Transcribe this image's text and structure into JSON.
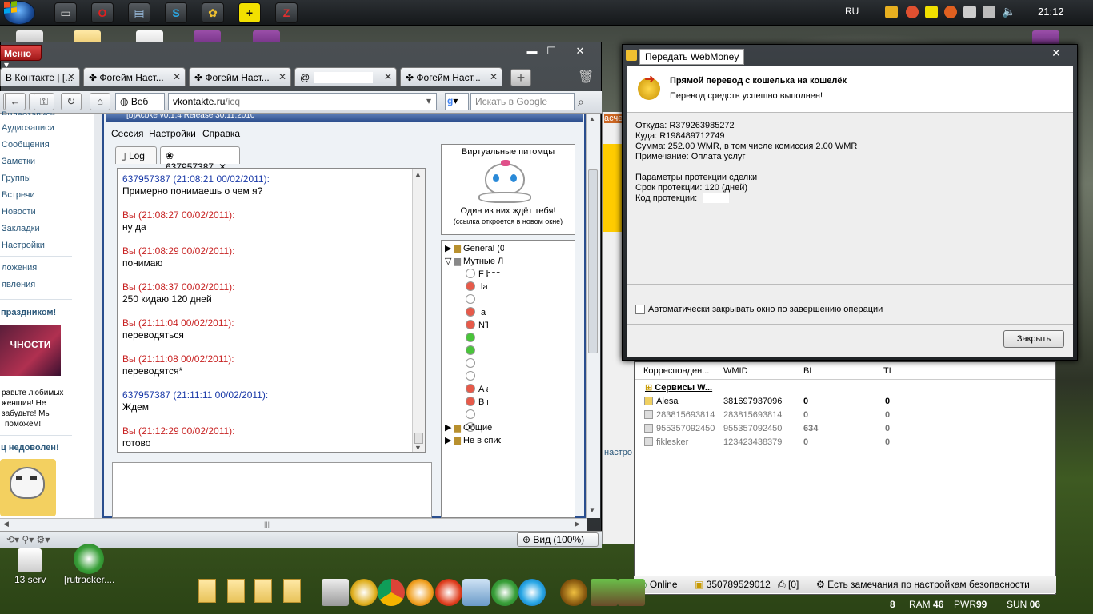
{
  "taskbar_top": {
    "language": "RU",
    "clock": "21:12"
  },
  "desktop": {
    "icons": [
      {
        "label": "13 serv"
      },
      {
        "label": "[rutracker...."
      }
    ]
  },
  "opera": {
    "menu_label": "Меню",
    "tabs": [
      {
        "label": "В Контакте | [..."
      },
      {
        "label": "Фогейм Наст..."
      },
      {
        "label": "Фогейм Наст..."
      },
      {
        "label": "@"
      },
      {
        "label": "Фогейм Наст..."
      }
    ],
    "search_engine_label": "Веб",
    "address_host": "vkontakte.ru",
    "address_path": "/icq",
    "search_placeholder": "Искать в Google",
    "zoom_label": "Вид (100%)"
  },
  "vk": {
    "top_cut": "Видеозаписи",
    "nav": [
      "Аудиозаписи",
      "Сообщения",
      "Заметки",
      "Группы",
      "Встречи",
      "Новости",
      "Закладки",
      "Настройки"
    ],
    "apps": [
      "ложения",
      "явления"
    ],
    "promo_title": "праздником!",
    "promo_text": [
      "равьте любимых",
      "женщин! Не",
      "забудьте! Мы",
      "поможем!"
    ],
    "promo_image_text": "ЧНОСТИ",
    "app2_title": "ц недоволен!"
  },
  "icq": {
    "title": "[b]Acbke v0.1.4 Release 30.11.2010",
    "menu": [
      "Сессия",
      "Настройки",
      "Справка"
    ],
    "tabs": [
      {
        "label": "Log"
      },
      {
        "label": "637957387"
      }
    ],
    "messages": [
      {
        "from": "them",
        "header": "637957387 (21:08:21 00/02/2011):",
        "text": "Примерно понимаешь о чем я?"
      },
      {
        "from": "me",
        "header": "Вы (21:08:27 00/02/2011):",
        "text": "ну да"
      },
      {
        "from": "me",
        "header": "Вы (21:08:29 00/02/2011):",
        "text": "понимаю"
      },
      {
        "from": "me",
        "header": "Вы (21:08:37 00/02/2011):",
        "text": "250 кидаю 120 дней"
      },
      {
        "from": "me",
        "header": "Вы (21:11:04 00/02/2011):",
        "text": "переводяться"
      },
      {
        "from": "me",
        "header": "Вы (21:11:08 00/02/2011):",
        "text": "переводятся*"
      },
      {
        "from": "them",
        "header": "637957387 (21:11:11 00/02/2011):",
        "text": "Ждем"
      },
      {
        "from": "me",
        "header": "Вы (21:12:29 00/02/2011):",
        "text": "готово"
      }
    ],
    "pets": {
      "title": "Виртуальные питомцы",
      "text": "Один из них ждёт тебя!",
      "note": "(ссылка откроется в новом окне)"
    },
    "groups": [
      {
        "label": "General (0"
      },
      {
        "label": "Мутные Люди"
      },
      {
        "label": "Общие"
      },
      {
        "label": "Не в списке"
      }
    ],
    "contacts": [
      {
        "label": "F  bos",
        "color": "#ffffff"
      },
      {
        "label": "   las",
        "color": "#e65a4a"
      },
      {
        "label": "",
        "color": "#ffffff"
      },
      {
        "label": "  a ",
        "color": "#e65a4a"
      },
      {
        "label": "NT  ",
        "color": "#e65a4a"
      },
      {
        "label": "",
        "color": "#49c43a"
      },
      {
        "label": "",
        "color": "#49c43a"
      },
      {
        "label": "",
        "color": "#ffffff"
      },
      {
        "label": "",
        "color": "#ffffff"
      },
      {
        "label": "A      a",
        "color": "#e65a4a"
      },
      {
        "label": "B    nnat",
        "color": "#e65a4a"
      },
      {
        "label": "",
        "color": "#ffffff"
      },
      {
        "label": "",
        "color": "#ffffff"
      }
    ]
  },
  "webmoney_dialog": {
    "title": "Передать WebMoney",
    "heading": "Прямой перевод с кошелька на кошелёк",
    "subheading": "Перевод средств успешно выполнен!",
    "from": "Откуда: R379263985272",
    "to": "Куда: R198489712749",
    "sum": "Сумма: 252.00 WMR, в том числе комиссия 2.00 WMR",
    "note": "Примечание: Оплата услуг",
    "protect_title": "Параметры протекции сделки",
    "protect_term": "Срок протекции: 120 (дней)",
    "protect_code": "Код протекции:",
    "auto_close": "Автоматически закрывать окно по завершению операции",
    "close_button": "Закрыть"
  },
  "wm_keeper": {
    "columns": [
      "Корреспонден...",
      "WMID",
      "BL",
      "TL"
    ],
    "group": "Сервисы W...",
    "rows": [
      {
        "name": "Alesa",
        "wmid": "381697937096",
        "bl": "0",
        "tl": "0"
      },
      {
        "name": "283815693814",
        "wmid": "283815693814",
        "bl": "0",
        "tl": "0"
      },
      {
        "name": "955357092450",
        "wmid": "955357092450",
        "bl": "634",
        "tl": "0"
      },
      {
        "name": "fiklesker",
        "wmid": "123423438379",
        "bl": "0",
        "tl": "0"
      }
    ],
    "status_online": "Online",
    "status_wmid": "350789529012",
    "status_count": "[0]",
    "status_warning": "Есть замечания по настройкам безопасности",
    "behind_label": "настрo",
    "behind_label2": "асчет"
  },
  "sysmon": {
    "ram_label": "RAM",
    "ram": "46",
    "pwr_label": "PWR",
    "pwr": "99",
    "sun_label": "SUN",
    "sun": "06",
    "other": "8"
  },
  "colors": {
    "icq_them": "#1a3aa8",
    "icq_me": "#c82222",
    "vk_link": "#2b587a",
    "opera_menu": "#c82828"
  }
}
